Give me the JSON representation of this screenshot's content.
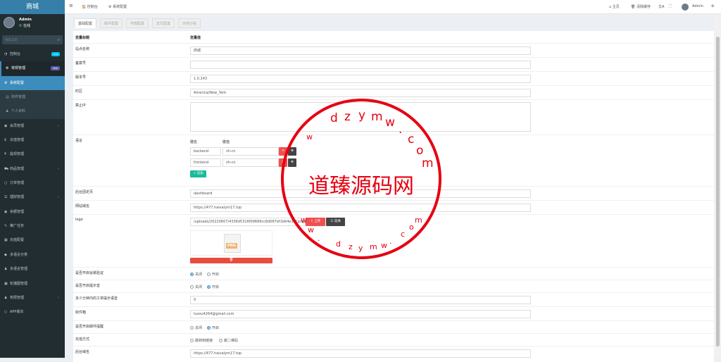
{
  "app": {
    "title": "商城"
  },
  "user": {
    "name": "Admin",
    "status": "在线"
  },
  "search": {
    "placeholder": "搜索菜单"
  },
  "sidebar": {
    "items": [
      {
        "label": "控制台",
        "icon": "dashboard-icon",
        "badge": "hot",
        "badge_color": "#00c0ef"
      },
      {
        "label": "常规管理",
        "icon": "cogs-icon",
        "badge": "new",
        "badge_color": "#605ca8"
      },
      {
        "label": "系统配置",
        "icon": "gear-icon"
      },
      {
        "label": "附件管理",
        "icon": "file-image-icon"
      },
      {
        "label": "个人资料",
        "icon": "user-icon"
      },
      {
        "label": "会员管理",
        "icon": "user-circle-icon"
      },
      {
        "label": "充值管理",
        "icon": "dollar-icon"
      },
      {
        "label": "提现管理",
        "icon": "yen-icon"
      },
      {
        "label": "商品管理",
        "icon": "cart-icon"
      },
      {
        "label": "订单管理",
        "icon": "circle-o-icon"
      },
      {
        "label": "理财管理",
        "icon": "list-icon"
      },
      {
        "label": "余额管理",
        "icon": "circle-dot-icon"
      },
      {
        "label": "推广任务",
        "icon": "share-icon"
      },
      {
        "label": "充值配置",
        "icon": "grid-icon"
      },
      {
        "label": "多语言分类",
        "icon": "tag-icon"
      },
      {
        "label": "多语言管理",
        "icon": "users-icon"
      },
      {
        "label": "轮播图管理",
        "icon": "image-icon"
      },
      {
        "label": "权限管理",
        "icon": "group-icon"
      },
      {
        "label": "APP版本",
        "icon": "circle-icon"
      }
    ]
  },
  "header": {
    "menu_icon": "≡",
    "crumb1": "控制台",
    "crumb2": "系统配置",
    "home": "主页",
    "clear_cache": "清除缓存",
    "translate": "文A",
    "fullscreen": "⛶",
    "admin": "Admin"
  },
  "tabs": [
    "基础配置",
    "邮件配置",
    "字典配置",
    "支付配置",
    "示例分组"
  ],
  "table": {
    "col1": "变量标题",
    "col2": "变量值"
  },
  "fields": {
    "site_name": {
      "label": "站点名称",
      "value": "商城"
    },
    "beian": {
      "label": "备案号",
      "value": ""
    },
    "version": {
      "label": "版本号",
      "value": "1.0.243"
    },
    "timezone": {
      "label": "时区",
      "value": "America/New_York"
    },
    "forbid_ip": {
      "label": "禁止IP",
      "value": ""
    },
    "language": {
      "label": "语言",
      "key_header": "键名",
      "val_header": "键值",
      "rows": [
        {
          "key": "backend",
          "val": "zh-cn"
        },
        {
          "key": "frontend",
          "val": "zh-cn"
        }
      ],
      "add_label": "+ 追加"
    },
    "backend_index": {
      "label": "后台固定页",
      "value": "dashboard"
    },
    "site_domain": {
      "label": "网站域名",
      "value": "https://477.haivalym17.top"
    },
    "logo": {
      "label": "logo",
      "value": "/uploads/20220607/4336d5316f09689cc8d087ef1b64e39f.png",
      "upload": "上传",
      "select": "选择",
      "thumb_text": "PNG"
    },
    "captcha": {
      "label": "是否开启谷歌验证",
      "opt1": "关闭",
      "opt2": "开启"
    },
    "tips": {
      "label": "是否开启提示音",
      "opt1": "关闭",
      "opt2": "开启"
    },
    "work_tip": {
      "label": "多少分钟内的工单提示语音",
      "value": "0"
    },
    "receive_email": {
      "label": "收件箱",
      "value": "luoxu4264@gmail.com"
    },
    "email_notify": {
      "label": "是否开启邮件提醒",
      "opt1": "关闭",
      "opt2": "开启"
    },
    "recharge": {
      "label": "充值方式",
      "opt1": "跳转到链接",
      "opt2": "跳二维码"
    },
    "backend_domain": {
      "label": "后台域名",
      "value": "https://477.haivalym17.top"
    }
  },
  "stamp": {
    "center": "道臻源码网",
    "top_letters": [
      "w",
      "d",
      "z",
      "y",
      "m",
      "w",
      ".",
      "c",
      "o",
      "m"
    ],
    "bottom_letters": [
      "w",
      "w",
      ".",
      "d",
      "z",
      "y",
      "m",
      "w",
      ".",
      "c",
      "o",
      "m"
    ]
  },
  "colors": {
    "sidebar": "#222d32",
    "accent": "#3c8dbc",
    "danger": "#f05050",
    "success": "#18bc9c",
    "stamp": "#e60012"
  }
}
